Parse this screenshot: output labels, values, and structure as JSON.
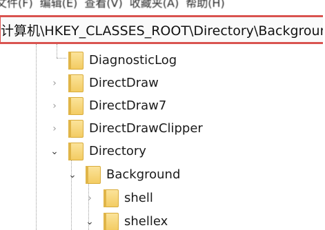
{
  "menubar": {
    "items": [
      {
        "label": "文件(F)"
      },
      {
        "label": "编辑(E)"
      },
      {
        "label": "查看(V)"
      },
      {
        "label": "收藏夹(A)"
      },
      {
        "label": "帮助(H)"
      }
    ]
  },
  "address": {
    "path": "计算机\\HKEY_CLASSES_ROOT\\Directory\\Background\\shellex"
  },
  "tree": {
    "items": [
      {
        "label": "DiagnosticLog",
        "expanded": null
      },
      {
        "label": "DirectDraw",
        "expanded": false
      },
      {
        "label": "DirectDraw7",
        "expanded": false
      },
      {
        "label": "DirectDrawClipper",
        "expanded": false
      },
      {
        "label": "Directory",
        "expanded": true
      },
      {
        "label": "Background",
        "expanded": true
      },
      {
        "label": "shell",
        "expanded": false
      },
      {
        "label": "shellex",
        "expanded": true
      }
    ]
  },
  "colors": {
    "highlight_border": "#d9534f",
    "folder_fill": "#f3cc63",
    "folder_border": "#d8ab3a"
  }
}
